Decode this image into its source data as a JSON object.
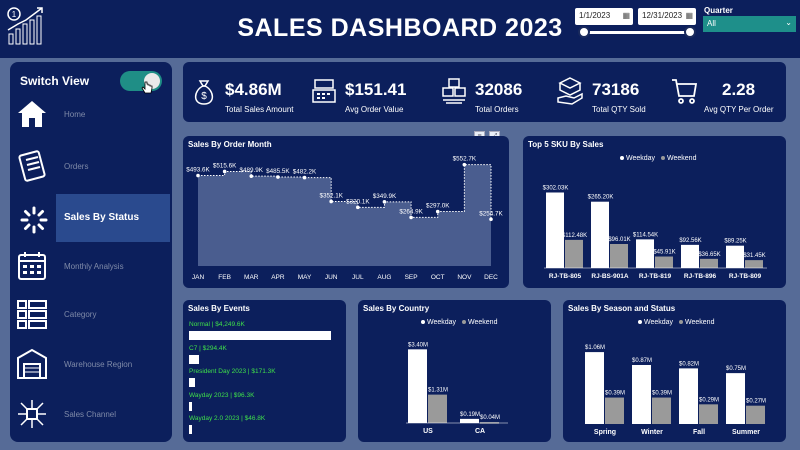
{
  "header": {
    "title": "SALES DASHBOARD 2023",
    "start_date": "1/1/2023",
    "end_date": "12/31/2023",
    "quarter_label": "Quarter",
    "quarter_value": "All"
  },
  "sidebar": {
    "switch_label": "Switch View",
    "items": [
      {
        "label": "Home",
        "icon": "home-icon"
      },
      {
        "label": "Orders",
        "icon": "orders-icon"
      },
      {
        "label": "Sales By Status",
        "icon": "loading-icon"
      },
      {
        "label": "Monthly Analysis",
        "icon": "calendar-icon"
      },
      {
        "label": "Category",
        "icon": "category-icon"
      },
      {
        "label": "Warehouse Region",
        "icon": "warehouse-icon"
      },
      {
        "label": "Sales Channel",
        "icon": "channel-icon"
      }
    ]
  },
  "kpis": [
    {
      "value": "$4.86M",
      "label": "Total Sales Amount",
      "icon": "money-bag-icon"
    },
    {
      "value": "$151.41",
      "label": "Avg Order Value",
      "icon": "cash-register-icon"
    },
    {
      "value": "32086",
      "label": "Total Orders",
      "icon": "boxes-icon"
    },
    {
      "value": "73186",
      "label": "Total QTY Sold",
      "icon": "hand-box-icon"
    },
    {
      "value": "2.28",
      "label": "Avg QTY Per Order",
      "icon": "cart-icon"
    }
  ],
  "panels": {
    "monthly": "Sales By Order Month",
    "sku": "Top 5 SKU By Sales",
    "events": "Sales By Events",
    "country": "Sales By Country",
    "season": "Sales By Season and Status"
  },
  "legend": {
    "weekday": "Weekday",
    "weekend": "Weekend"
  },
  "colors": {
    "navy": "#0c1f5c",
    "bg": "#566b97",
    "weekday": "#ffffff",
    "weekend": "#9a9a9a",
    "accent": "#1f8e86",
    "event_text": "#3fe04a"
  },
  "events": [
    {
      "label": "Normal | $4,249.6K",
      "value": 4249.6
    },
    {
      "label": "C7 | $294.4K",
      "value": 294.4
    },
    {
      "label": "President Day 2023 | $171.3K",
      "value": 171.3
    },
    {
      "label": "Wayday 2023 | $96.3K",
      "value": 96.3
    },
    {
      "label": "Wayday 2.0 2023 | $46.8K",
      "value": 46.8
    }
  ],
  "chart_data": [
    {
      "type": "area",
      "title": "Sales By Order Month",
      "categories": [
        "JAN",
        "FEB",
        "MAR",
        "APR",
        "MAY",
        "JUN",
        "JUL",
        "AUG",
        "SEP",
        "OCT",
        "NOV",
        "DEC"
      ],
      "values": [
        493.6,
        515.6,
        489.9,
        485.5,
        482.2,
        352.1,
        320.1,
        349.9,
        264.9,
        297.0,
        552.7,
        254.7
      ],
      "labels": [
        "$493.6K",
        "$515.6K",
        "$489.9K",
        "$485.5K",
        "$482.2K",
        "$352.1K",
        "$320.1K",
        "$349.9K",
        "$264.9K",
        "$297.0K",
        "$552.7K",
        "$254.7K"
      ],
      "ylim": [
        0,
        600
      ]
    },
    {
      "type": "bar",
      "title": "Top 5 SKU By Sales",
      "categories": [
        "RJ-TB-805",
        "RJ-BS-901A",
        "RJ-TB-819",
        "RJ-TB-896",
        "RJ-TB-809"
      ],
      "series": [
        {
          "name": "Weekday",
          "values": [
            302.03,
            265.2,
            114.54,
            92.56,
            89.25
          ],
          "labels": [
            "$302.03K",
            "$265.20K",
            "$114.54K",
            "$92.56K",
            "$89.25K"
          ]
        },
        {
          "name": "Weekend",
          "values": [
            112.48,
            96.01,
            45.91,
            36.65,
            31.45
          ],
          "labels": [
            "$112.48K",
            "$96.01K",
            "$45.91K",
            "$36.65K",
            "$31.45K"
          ]
        }
      ],
      "ylim": [
        0,
        320
      ]
    },
    {
      "type": "bar",
      "title": "Sales By Events",
      "categories": [
        "Normal",
        "C7",
        "President Day 2023",
        "Wayday 2023",
        "Wayday 2.0 2023"
      ],
      "values": [
        4249.6,
        294.4,
        171.3,
        96.3,
        46.8
      ]
    },
    {
      "type": "bar",
      "title": "Sales By Country",
      "categories": [
        "US",
        "CA"
      ],
      "series": [
        {
          "name": "Weekday",
          "values": [
            3.4,
            0.19
          ],
          "labels": [
            "$3.40M",
            "$0.19M"
          ]
        },
        {
          "name": "Weekend",
          "values": [
            1.31,
            0.04
          ],
          "labels": [
            "$1.31M",
            "$0.04M"
          ]
        }
      ],
      "ylim": [
        0,
        3.6
      ]
    },
    {
      "type": "bar",
      "title": "Sales By Season and Status",
      "categories": [
        "Spring",
        "Winter",
        "Fall",
        "Summer"
      ],
      "series": [
        {
          "name": "Weekday",
          "values": [
            1.06,
            0.87,
            0.82,
            0.75
          ],
          "labels": [
            "$1.06M",
            "$0.87M",
            "$0.82M",
            "$0.75M"
          ]
        },
        {
          "name": "Weekend",
          "values": [
            0.39,
            0.39,
            0.29,
            0.27
          ],
          "labels": [
            "$0.39M",
            "$0.39M",
            "$0.29M",
            "$0.27M"
          ]
        }
      ],
      "ylim": [
        0,
        1.15
      ]
    }
  ]
}
